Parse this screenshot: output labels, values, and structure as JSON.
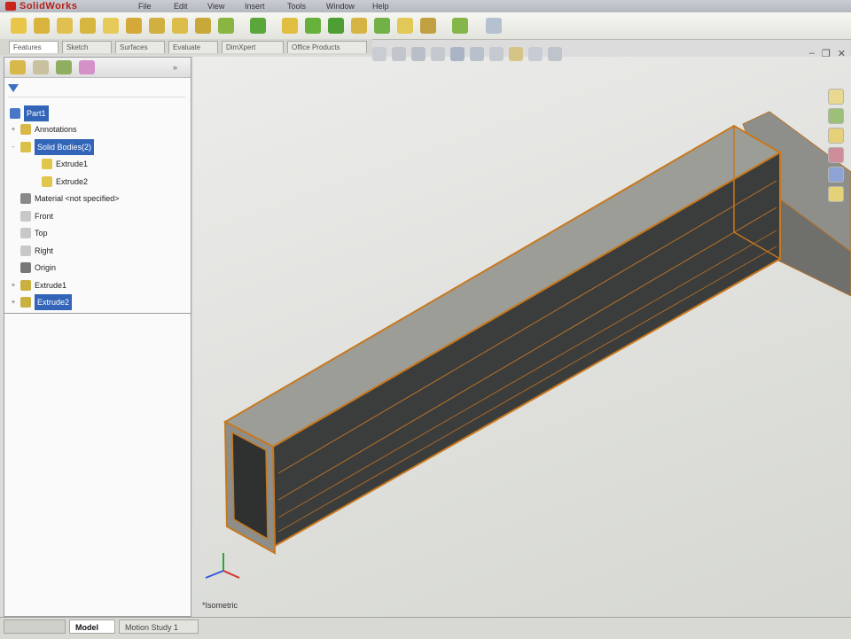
{
  "app": {
    "logo_text": "SolidWorks",
    "menus": [
      "File",
      "Edit",
      "View",
      "Insert",
      "Tools",
      "Window",
      "Help"
    ]
  },
  "tabs": [
    "Features",
    "Sketch",
    "Surfaces",
    "Evaluate",
    "DimXpert",
    "Office Products"
  ],
  "panel": {
    "filter_icon": "funnel-icon",
    "root_label": "Part1",
    "tree": [
      {
        "label": "Annotations",
        "icon": "annotations-icon",
        "indent": 0,
        "expander": "+"
      },
      {
        "label": "Solid Bodies(2)",
        "icon": "solid-bodies-icon",
        "indent": 0,
        "expander": "-",
        "selected": true
      },
      {
        "label": "Extrude1",
        "icon": "body-icon",
        "indent": 1,
        "expander": ""
      },
      {
        "label": "Extrude2",
        "icon": "body-icon",
        "indent": 1,
        "expander": ""
      },
      {
        "label": "Material <not specified>",
        "icon": "material-icon",
        "indent": 0,
        "expander": ""
      },
      {
        "label": "Front",
        "icon": "plane-icon",
        "indent": 0,
        "expander": ""
      },
      {
        "label": "Top",
        "icon": "plane-icon",
        "indent": 0,
        "expander": ""
      },
      {
        "label": "Right",
        "icon": "plane-icon",
        "indent": 0,
        "expander": ""
      },
      {
        "label": "Origin",
        "icon": "origin-icon",
        "indent": 0,
        "expander": ""
      },
      {
        "label": "Extrude1",
        "icon": "extrude-icon",
        "indent": 0,
        "expander": "+"
      },
      {
        "label": "Extrude2",
        "icon": "extrude-icon",
        "indent": 0,
        "expander": "+",
        "selected": true
      }
    ]
  },
  "bottom_tabs": [
    "Model",
    "Motion Study 1"
  ],
  "viewport": {
    "view_label": "*Isometric",
    "colors": {
      "edge": "#c8781e",
      "body": "#8c8c86",
      "body_dark": "#3b3d3c"
    }
  }
}
